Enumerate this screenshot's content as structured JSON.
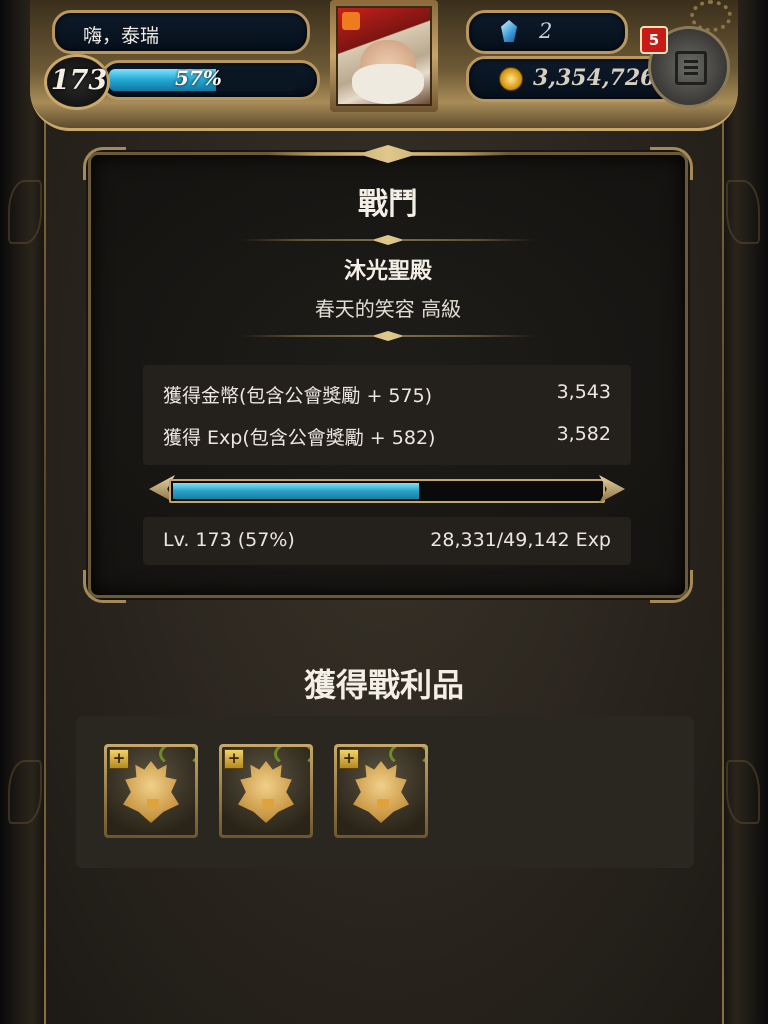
{
  "hud": {
    "player_name": "嗨，泰瑞",
    "level": "173",
    "exp_percent_label": "57%",
    "exp_progress": 0.57,
    "gems": "2",
    "gold": "3,354,726",
    "notification_count": "5"
  },
  "battle": {
    "title": "戰鬥",
    "stage_name": "沐光聖殿",
    "stage_subtitle": "春天的笑容 高級",
    "rewards": [
      {
        "label": "獲得金幣(包含公會獎勵 + 575)",
        "value": "3,543"
      },
      {
        "label": "獲得 Exp(包含公會獎勵 + 582)",
        "value": "3,582"
      }
    ],
    "exp_progress": 0.57,
    "level_label": "Lv. 173 (57%)",
    "exp_label": "28,331/49,142 Exp"
  },
  "loot": {
    "title": "獲得戰利品",
    "items": [
      {
        "icon": "chocobo-chick-icon",
        "badge": "+"
      },
      {
        "icon": "chocobo-chick-icon",
        "badge": "+"
      },
      {
        "icon": "chocobo-chick-icon",
        "badge": "+"
      }
    ]
  }
}
